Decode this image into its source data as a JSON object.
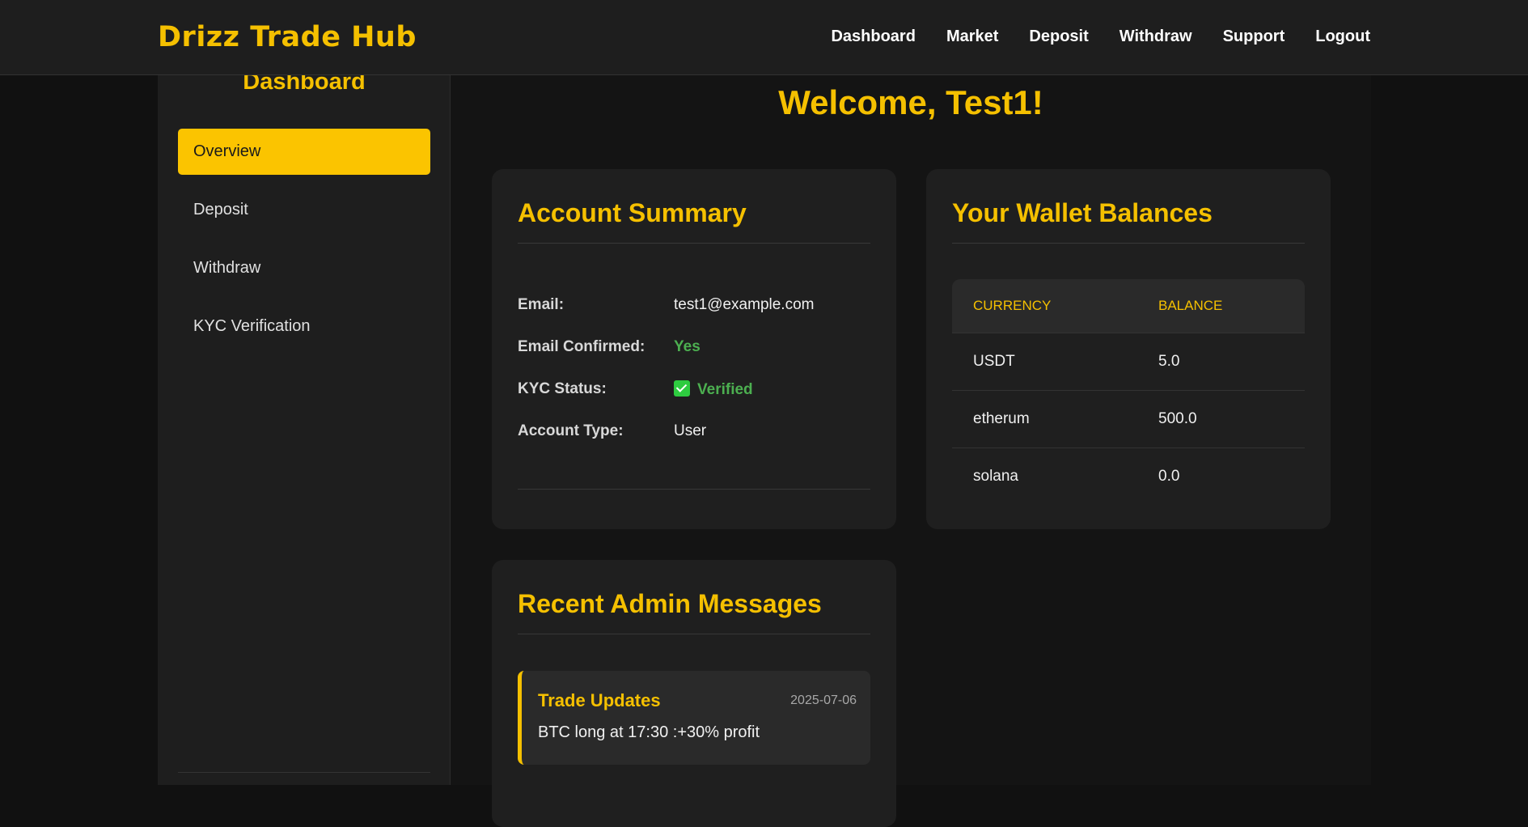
{
  "navbar": {
    "brand": "Drizz Trade Hub",
    "links": [
      "Dashboard",
      "Market",
      "Deposit",
      "Withdraw",
      "Support",
      "Logout"
    ]
  },
  "sidebar": {
    "title": "Dashboard",
    "items": [
      {
        "label": "Overview",
        "active": true
      },
      {
        "label": "Deposit",
        "active": false
      },
      {
        "label": "Withdraw",
        "active": false
      },
      {
        "label": "KYC Verification",
        "active": false
      }
    ]
  },
  "main": {
    "welcome": "Welcome, Test1!"
  },
  "account_summary": {
    "title": "Account Summary",
    "email_label": "Email:",
    "email_value": "test1@example.com",
    "email_confirmed_label": "Email Confirmed:",
    "email_confirmed_value": "Yes",
    "kyc_label": "KYC Status:",
    "kyc_value": "Verified",
    "account_type_label": "Account Type:",
    "account_type_value": "User"
  },
  "wallet": {
    "title": "Your Wallet Balances",
    "headers": [
      "CURRENCY",
      "BALANCE"
    ],
    "rows": [
      {
        "currency": "USDT",
        "balance": "5.0"
      },
      {
        "currency": "etherum",
        "balance": "500.0"
      },
      {
        "currency": "solana",
        "balance": "0.0"
      }
    ]
  },
  "messages": {
    "title": "Recent Admin Messages",
    "items": [
      {
        "title": "Trade Updates",
        "date": "2025-07-06",
        "body": "BTC long at 17:30 :+30% profit"
      }
    ]
  },
  "colors": {
    "accent": "#f5c000",
    "success": "#4caf50",
    "background": "#111111",
    "card": "#1f1f1f"
  }
}
